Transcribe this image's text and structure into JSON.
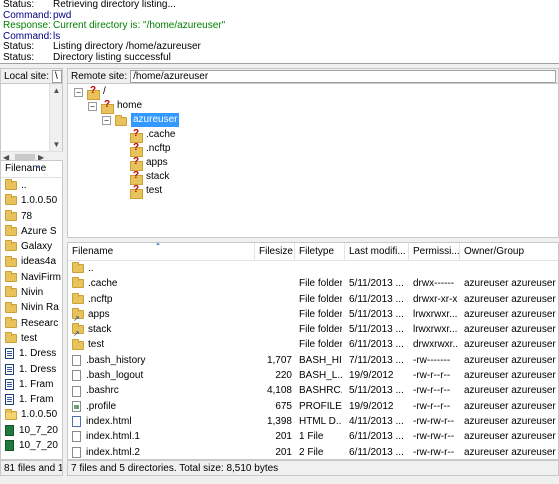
{
  "log": [
    {
      "label": "Status:",
      "text": "Retrieving directory listing...",
      "kind": "status"
    },
    {
      "label": "Command:",
      "text": "pwd",
      "kind": "command"
    },
    {
      "label": "Response:",
      "text": "Current directory is: \"/home/azureuser\"",
      "kind": "response"
    },
    {
      "label": "Command:",
      "text": "ls",
      "kind": "command"
    },
    {
      "label": "Status:",
      "text": "Listing directory /home/azureuser",
      "kind": "status"
    },
    {
      "label": "Status:",
      "text": "Directory listing successful",
      "kind": "status"
    }
  ],
  "local": {
    "site_label": "Local site:",
    "site_value": "\\",
    "filename_header": "Filename",
    "items": [
      {
        "name": "..",
        "icon": "folder-icon"
      },
      {
        "name": "1.0.0.50",
        "icon": "folder-icon"
      },
      {
        "name": "78",
        "icon": "folder-icon"
      },
      {
        "name": "Azure S",
        "icon": "folder-icon"
      },
      {
        "name": "Galaxy",
        "icon": "folder-icon"
      },
      {
        "name": "ideas4a",
        "icon": "folder-icon"
      },
      {
        "name": "NaviFirm",
        "icon": "folder-icon"
      },
      {
        "name": "Nivin",
        "icon": "folder-icon"
      },
      {
        "name": "Nivin Ra",
        "icon": "folder-icon"
      },
      {
        "name": "Researc",
        "icon": "folder-icon"
      },
      {
        "name": "test",
        "icon": "folder-icon"
      },
      {
        "name": "1. Dress",
        "icon": "doc-icon"
      },
      {
        "name": "1. Dress",
        "icon": "doc-icon"
      },
      {
        "name": "1. Fram",
        "icon": "doc-icon"
      },
      {
        "name": "1. Fram",
        "icon": "doc-icon"
      },
      {
        "name": "1.0.0.50",
        "icon": "zip-folder-icon"
      },
      {
        "name": "10_7_20",
        "icon": "excel-icon"
      },
      {
        "name": "10_7_20",
        "icon": "excel-icon"
      }
    ],
    "status": "81 files and 10"
  },
  "remote": {
    "site_label": "Remote site:",
    "site_value": "/home/azureuser",
    "tree": {
      "root": "/",
      "home": "home",
      "selected": "azureuser",
      "children": [
        ".cache",
        ".ncftp",
        "apps",
        "stack",
        "test"
      ]
    },
    "columns": [
      "Filename",
      "Filesize",
      "Filetype",
      "Last modifi...",
      "Permissi...",
      "Owner/Group"
    ],
    "rows": [
      {
        "name": "..",
        "size": "",
        "type": "",
        "modified": "",
        "perms": "",
        "owner": "",
        "icon": "folder-icon"
      },
      {
        "name": ".cache",
        "size": "",
        "type": "File folder",
        "modified": "5/11/2013 ...",
        "perms": "drwx------",
        "owner": "azureuser azureuser",
        "icon": "folder-icon"
      },
      {
        "name": ".ncftp",
        "size": "",
        "type": "File folder",
        "modified": "6/11/2013 ...",
        "perms": "drwxr-xr-x",
        "owner": "azureuser azureuser",
        "icon": "folder-icon"
      },
      {
        "name": "apps",
        "size": "",
        "type": "File folder",
        "modified": "5/11/2013 ...",
        "perms": "lrwxrwxr...",
        "owner": "azureuser azureuser",
        "icon": "link-folder-icon"
      },
      {
        "name": "stack",
        "size": "",
        "type": "File folder",
        "modified": "5/11/2013 ...",
        "perms": "lrwxrwxr...",
        "owner": "azureuser azureuser",
        "icon": "link-folder-icon"
      },
      {
        "name": "test",
        "size": "",
        "type": "File folder",
        "modified": "6/11/2013 ...",
        "perms": "drwxrwxr...",
        "owner": "azureuser azureuser",
        "icon": "folder-icon"
      },
      {
        "name": ".bash_history",
        "size": "1,707",
        "type": "BASH_HI...",
        "modified": "7/11/2013 ...",
        "perms": "-rw-------",
        "owner": "azureuser azureuser",
        "icon": "file-icon"
      },
      {
        "name": ".bash_logout",
        "size": "220",
        "type": "BASH_L...",
        "modified": "19/9/2012",
        "perms": "-rw-r--r--",
        "owner": "azureuser azureuser",
        "icon": "file-icon"
      },
      {
        "name": ".bashrc",
        "size": "4,108",
        "type": "BASHRC...",
        "modified": "5/11/2013 ...",
        "perms": "-rw-r--r--",
        "owner": "azureuser azureuser",
        "icon": "file-icon"
      },
      {
        "name": ".profile",
        "size": "675",
        "type": "PROFILE ...",
        "modified": "19/9/2012",
        "perms": "-rw-r--r--",
        "owner": "azureuser azureuser",
        "icon": "profile-file-icon"
      },
      {
        "name": "index.html",
        "size": "1,398",
        "type": "HTML D...",
        "modified": "4/11/2013 ...",
        "perms": "-rw-rw-r--",
        "owner": "azureuser azureuser",
        "icon": "html-file-icon"
      },
      {
        "name": "index.html.1",
        "size": "201",
        "type": "1 File",
        "modified": "6/11/2013 ...",
        "perms": "-rw-rw-r--",
        "owner": "azureuser azureuser",
        "icon": "file-icon"
      },
      {
        "name": "index.html.2",
        "size": "201",
        "type": "2 File",
        "modified": "6/11/2013 ...",
        "perms": "-rw-rw-r--",
        "owner": "azureuser azureuser",
        "icon": "file-icon"
      }
    ],
    "status": "7 files and 5 directories. Total size: 8,510 bytes"
  }
}
